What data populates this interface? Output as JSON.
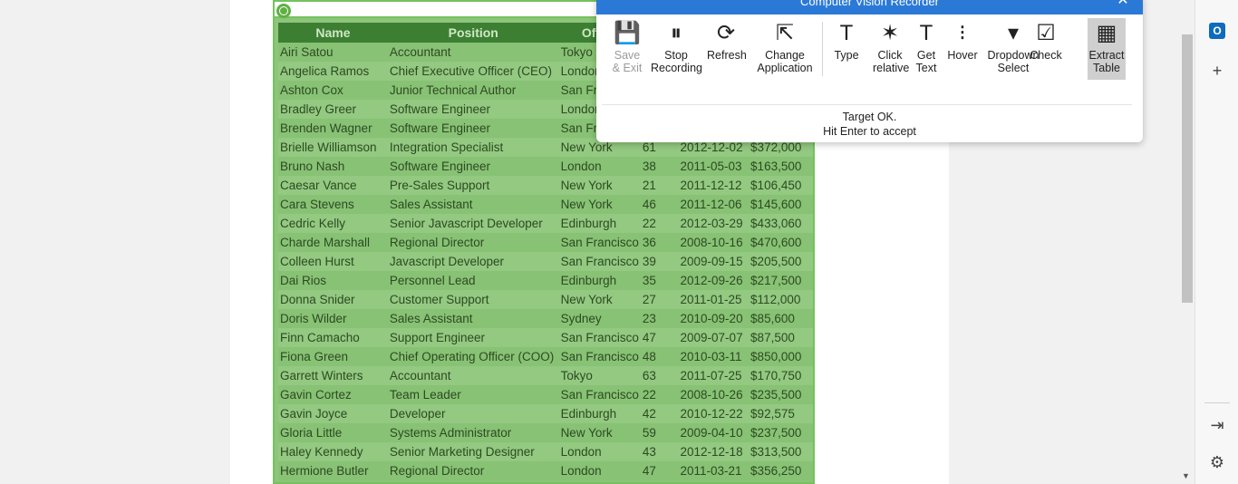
{
  "recorder": {
    "title": "Computer Vision Recorder",
    "tools": [
      {
        "label": "Save\n& Exit",
        "icon": "save-icon",
        "enabled": false
      },
      {
        "label": "Stop\nRecording",
        "icon": "pause-icon",
        "enabled": true
      },
      {
        "label": "Refresh",
        "icon": "refresh-icon",
        "enabled": true
      },
      {
        "label": "Change\nApplication",
        "icon": "change-application-icon",
        "enabled": true
      },
      {
        "label": "Type",
        "icon": "type-icon",
        "enabled": true
      },
      {
        "label": "Click\nrelative",
        "icon": "click-relative-icon",
        "enabled": true
      },
      {
        "label": "Get\nText",
        "icon": "get-text-icon",
        "enabled": true
      },
      {
        "label": "Hover",
        "icon": "hover-icon",
        "enabled": true
      },
      {
        "label": "Dropdown\nSelect",
        "icon": "dropdown-select-icon",
        "enabled": true
      },
      {
        "label": "Check",
        "icon": "check-icon",
        "enabled": true
      },
      {
        "label": "Extract\nTable",
        "icon": "extract-table-icon",
        "enabled": true,
        "active": true
      }
    ],
    "status_line1": "Target OK.",
    "status_line2": "Hit Enter to accept"
  },
  "table": {
    "headers": [
      "Name",
      "Position",
      "Office",
      "",
      "",
      ""
    ],
    "rows": [
      [
        "Airi Satou",
        "Accountant",
        "Tokyo",
        "",
        "",
        ""
      ],
      [
        "Angelica Ramos",
        "Chief Executive Officer (CEO)",
        "London",
        "",
        "",
        ""
      ],
      [
        "Ashton Cox",
        "Junior Technical Author",
        "San Francisco",
        "",
        "",
        ""
      ],
      [
        "Bradley Greer",
        "Software Engineer",
        "London",
        "",
        "",
        ""
      ],
      [
        "Brenden Wagner",
        "Software Engineer",
        "San Francisco",
        "",
        "",
        ""
      ],
      [
        "Brielle Williamson",
        "Integration Specialist",
        "New York",
        "61",
        "2012-12-02",
        "$372,000"
      ],
      [
        "Bruno Nash",
        "Software Engineer",
        "London",
        "38",
        "2011-05-03",
        "$163,500"
      ],
      [
        "Caesar Vance",
        "Pre-Sales Support",
        "New York",
        "21",
        "2011-12-12",
        "$106,450"
      ],
      [
        "Cara Stevens",
        "Sales Assistant",
        "New York",
        "46",
        "2011-12-06",
        "$145,600"
      ],
      [
        "Cedric Kelly",
        "Senior Javascript Developer",
        "Edinburgh",
        "22",
        "2012-03-29",
        "$433,060"
      ],
      [
        "Charde Marshall",
        "Regional Director",
        "San Francisco",
        "36",
        "2008-10-16",
        "$470,600"
      ],
      [
        "Colleen Hurst",
        "Javascript Developer",
        "San Francisco",
        "39",
        "2009-09-15",
        "$205,500"
      ],
      [
        "Dai Rios",
        "Personnel Lead",
        "Edinburgh",
        "35",
        "2012-09-26",
        "$217,500"
      ],
      [
        "Donna Snider",
        "Customer Support",
        "New York",
        "27",
        "2011-01-25",
        "$112,000"
      ],
      [
        "Doris Wilder",
        "Sales Assistant",
        "Sydney",
        "23",
        "2010-09-20",
        "$85,600"
      ],
      [
        "Finn Camacho",
        "Support Engineer",
        "San Francisco",
        "47",
        "2009-07-07",
        "$87,500"
      ],
      [
        "Fiona Green",
        "Chief Operating Officer (COO)",
        "San Francisco",
        "48",
        "2010-03-11",
        "$850,000"
      ],
      [
        "Garrett Winters",
        "Accountant",
        "Tokyo",
        "63",
        "2011-07-25",
        "$170,750"
      ],
      [
        "Gavin Cortez",
        "Team Leader",
        "San Francisco",
        "22",
        "2008-10-26",
        "$235,500"
      ],
      [
        "Gavin Joyce",
        "Developer",
        "Edinburgh",
        "42",
        "2010-12-22",
        "$92,575"
      ],
      [
        "Gloria Little",
        "Systems Administrator",
        "New York",
        "59",
        "2009-04-10",
        "$237,500"
      ],
      [
        "Haley Kennedy",
        "Senior Marketing Designer",
        "London",
        "43",
        "2012-12-18",
        "$313,500"
      ],
      [
        "Hermione Butler",
        "Regional Director",
        "London",
        "47",
        "2011-03-21",
        "$356,250"
      ]
    ]
  },
  "sidebar": {
    "items": [
      {
        "icon": "outlook-icon",
        "label": "O"
      },
      {
        "icon": "plus-icon",
        "label": "+"
      },
      {
        "icon": "sidebar-toggle-icon",
        "label": "⇥"
      },
      {
        "icon": "gear-icon",
        "label": "⚙"
      }
    ]
  },
  "colors": {
    "accent": "#2b79d6",
    "highlight": "#8dc57a",
    "highlight_border": "#74c25e",
    "header_bg": "#3c7f33"
  }
}
